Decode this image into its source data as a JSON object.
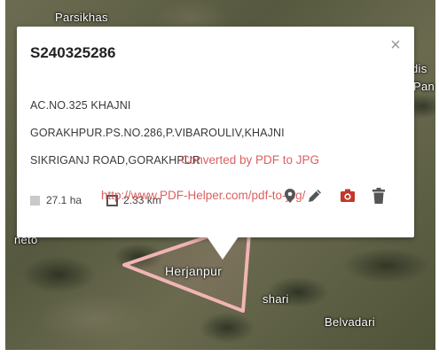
{
  "map": {
    "place_labels": {
      "parsikhas": "Parsikhas",
      "herjanpur": "Herjanpur",
      "shari": "shari",
      "belvadari": "Belvadari",
      "edge_top": "dis",
      "edge_mid": "Pan",
      "left_edge": "neto"
    },
    "boundary_color": "#f2b4b4"
  },
  "popup": {
    "title": "S240325286",
    "close_label": "×",
    "address_lines": [
      "AC.NO.325 KHAJNI",
      "GORAKHPUR.PS.NO.286,P.VIBAROULIV,KHAJNI",
      "SIKRIGANJ ROAD,GORAKHPUR"
    ],
    "stats": {
      "area": "27.1 ha",
      "perimeter": "2.33 km"
    },
    "actions": {
      "pin_icon": "map-pin-icon",
      "edit_icon": "pencil-icon",
      "camera_icon": "camera-icon",
      "delete_icon": "trash-icon"
    },
    "accent_color": "#c0392b"
  },
  "watermark": {
    "line1": "Converted by PDF to JPG",
    "line2": "http://www.PDF-Helper.com/pdf-to-jpg/"
  }
}
